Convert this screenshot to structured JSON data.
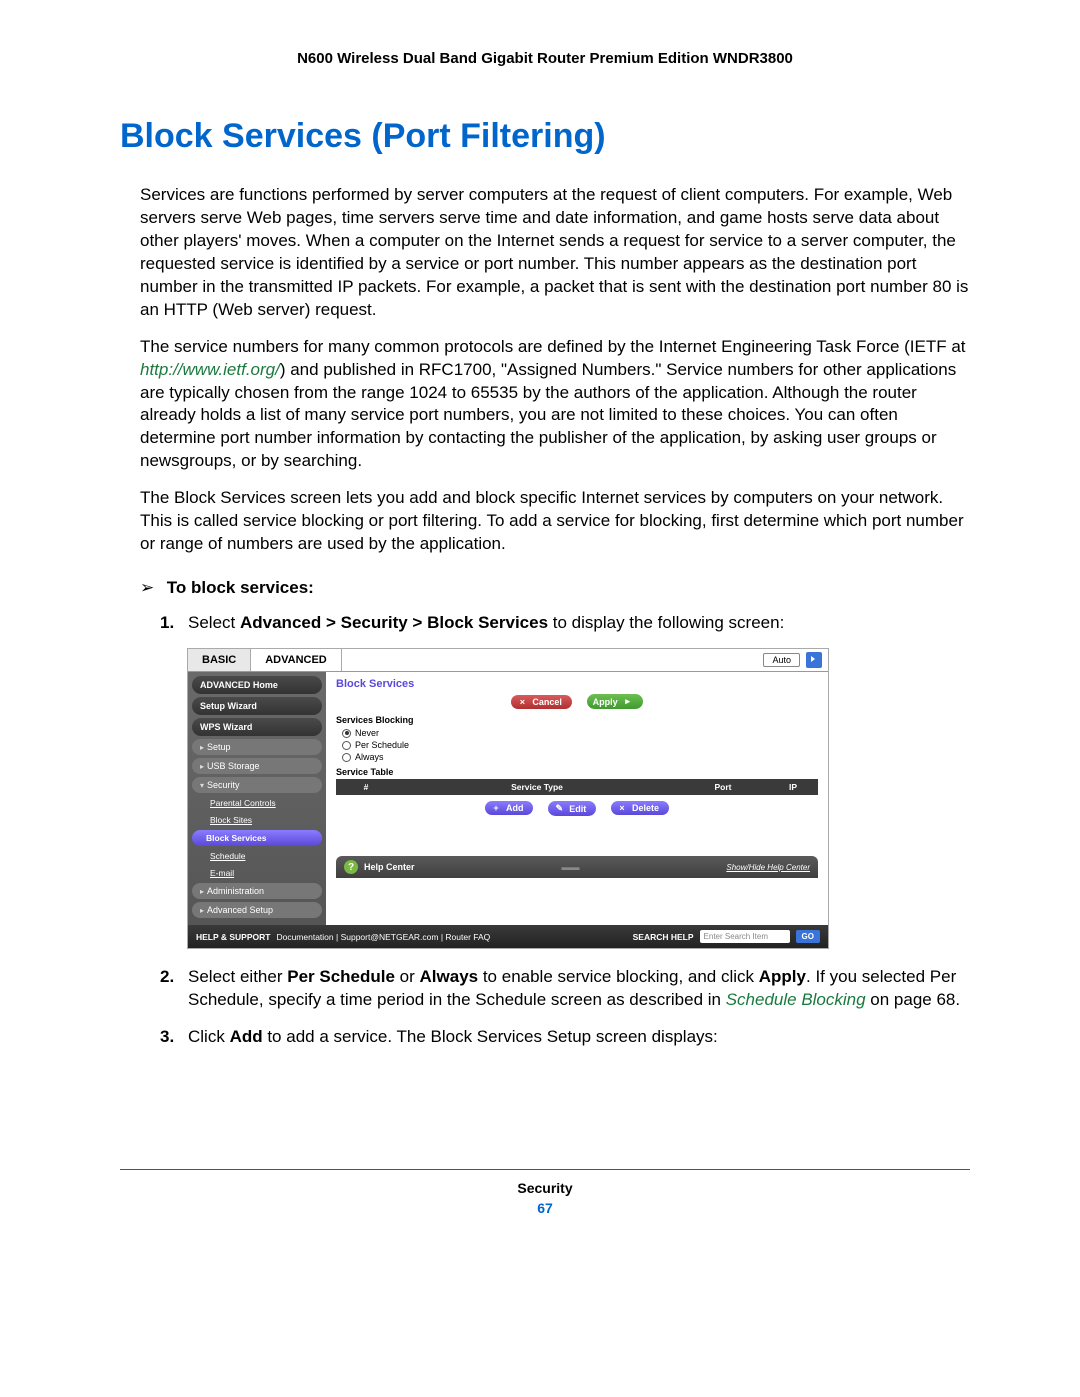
{
  "doc_header": "N600 Wireless Dual Band Gigabit Router Premium Edition WNDR3800",
  "section_title": "Block Services (Port Filtering)",
  "para1": "Services are functions performed by server computers at the request of client computers. For example, Web servers serve Web pages, time servers serve time and date information, and game hosts serve data about other players' moves. When a computer on the Internet sends a request for service to a server computer, the requested service is identified by a service or port number. This number appears as the destination port number in the transmitted IP packets. For example, a packet that is sent with the destination port number 80 is an HTTP (Web server) request.",
  "para2_a": "The service numbers for many common protocols are defined by the Internet Engineering Task Force (IETF at ",
  "ietf_link": "http://www.ietf.org/",
  "para2_b": ") and published in RFC1700, \"Assigned Numbers.\" Service numbers for other applications are typically chosen from the range 1024 to 65535 by the authors of the application. Although the router already holds a list of many service port numbers, you are not limited to these choices. You can often determine port number information by contacting the publisher of the application, by asking user groups or newsgroups, or by searching.",
  "para3": "The Block Services screen lets you add and block specific Internet services by computers on your network. This is called service blocking or port filtering. To add a service for blocking, first determine which port number or range of numbers are used by the application.",
  "proc_heading": "To block services:",
  "step1_a": "Select ",
  "step1_bold": "Advanced > Security > Block Services",
  "step1_b": " to display the following screen:",
  "step2_a": "Select either ",
  "step2_b1": "Per Schedule",
  "step2_mid": " or ",
  "step2_b2": "Always",
  "step2_c": " to enable service blocking, and click ",
  "step2_b3": "Apply",
  "step2_d": ". If you selected Per Schedule, specify a time period in the Schedule screen as described in ",
  "step2_xref": "Schedule Blocking",
  "step2_e": " on page 68.",
  "step3_a": "Click ",
  "step3_b1": "Add",
  "step3_b": " to add a service. The Block Services Setup screen displays:",
  "ui": {
    "tabs": {
      "basic": "BASIC",
      "advanced": "ADVANCED"
    },
    "auto": "Auto",
    "sidebar": {
      "adv_home": "ADVANCED Home",
      "setup_wizard": "Setup Wizard",
      "wps_wizard": "WPS Wizard",
      "setup": "Setup",
      "usb": "USB Storage",
      "security": "Security",
      "parental": "Parental Controls",
      "block_sites": "Block Sites",
      "block_services": "Block Services",
      "schedule": "Schedule",
      "email": "E-mail",
      "admin": "Administration",
      "adv_setup": "Advanced Setup"
    },
    "content": {
      "title": "Block Services",
      "cancel": "Cancel",
      "apply": "Apply",
      "services_blocking": "Services Blocking",
      "never": "Never",
      "per_schedule": "Per Schedule",
      "always": "Always",
      "service_table": "Service Table",
      "col_num": "#",
      "col_type": "Service Type",
      "col_port": "Port",
      "col_ip": "IP",
      "add": "Add",
      "edit": "Edit",
      "delete": "Delete",
      "help_center": "Help Center",
      "help_link": "Show/Hide Help Center"
    },
    "footer": {
      "help_support": "HELP & SUPPORT",
      "links": "Documentation | Support@NETGEAR.com | Router FAQ",
      "search_label": "SEARCH HELP",
      "search_placeholder": "Enter Search Item",
      "go": "GO"
    }
  },
  "footer": {
    "section": "Security",
    "page": "67"
  }
}
